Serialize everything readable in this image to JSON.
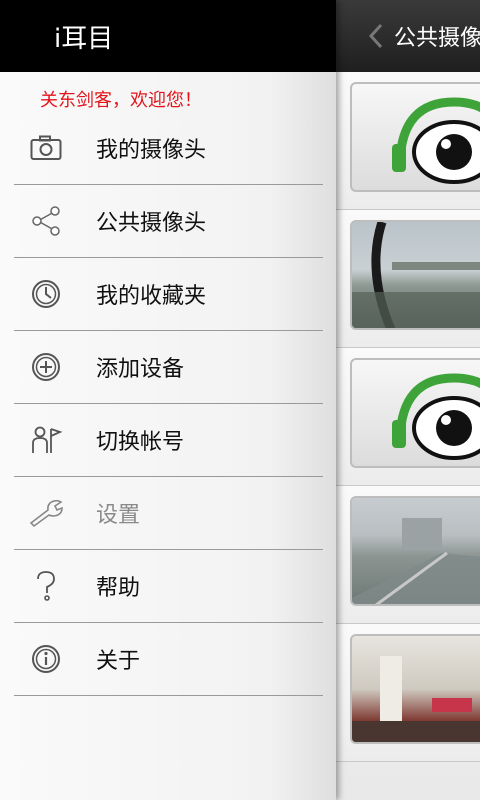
{
  "app": {
    "title": "i耳目"
  },
  "drawer": {
    "welcome": "关东剑客，欢迎您！",
    "items": [
      {
        "label": "我的摄像头",
        "icon": "camera-icon"
      },
      {
        "label": "公共摄像头",
        "icon": "share-icon"
      },
      {
        "label": "我的收藏夹",
        "icon": "clock-icon"
      },
      {
        "label": "添加设备",
        "icon": "add-circle-icon"
      },
      {
        "label": "切换帐号",
        "icon": "switch-account-icon"
      },
      {
        "label": "设置",
        "icon": "wrench-icon",
        "disabled": true
      },
      {
        "label": "帮助",
        "icon": "question-icon"
      },
      {
        "label": "关于",
        "icon": "info-icon"
      }
    ]
  },
  "content": {
    "title": "公共摄像头",
    "cameras": [
      {
        "kind": "logo"
      },
      {
        "kind": "photo"
      },
      {
        "kind": "logo"
      },
      {
        "kind": "photo"
      },
      {
        "kind": "photo"
      }
    ]
  },
  "colors": {
    "welcome": "#e3141b",
    "logo_green": "#3ea43a",
    "header_bg": "#000000"
  }
}
